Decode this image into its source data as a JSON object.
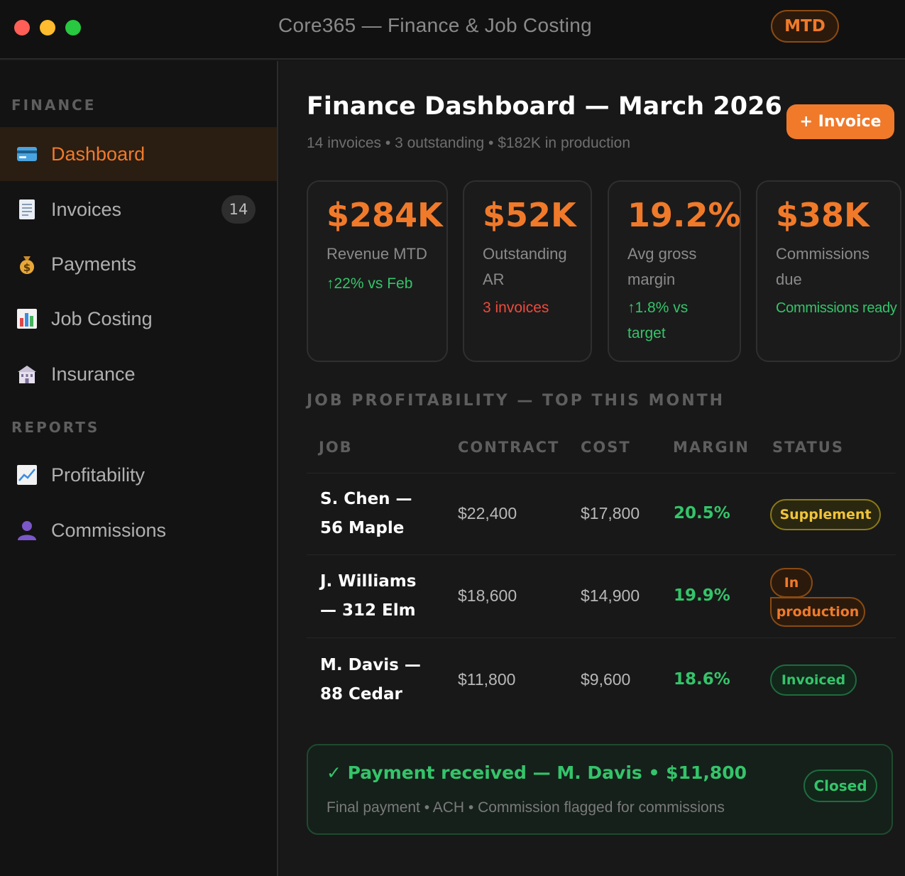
{
  "window": {
    "title": "Core365 — Finance & Job Costing",
    "period_badge": "MTD"
  },
  "sidebar": {
    "sections": [
      {
        "label": "FINANCE",
        "items": [
          {
            "label": "Dashboard",
            "icon": "credit-card-icon",
            "active": true
          },
          {
            "label": "Invoices",
            "icon": "document-icon",
            "badge": "14"
          },
          {
            "label": "Payments",
            "icon": "money-bag-icon"
          },
          {
            "label": "Job Costing",
            "icon": "bar-chart-icon"
          },
          {
            "label": "Insurance",
            "icon": "building-icon"
          }
        ]
      },
      {
        "label": "REPORTS",
        "items": [
          {
            "label": "Profitability",
            "icon": "trend-chart-icon"
          },
          {
            "label": "Commissions",
            "icon": "person-icon"
          }
        ]
      }
    ]
  },
  "header": {
    "title": "Finance Dashboard — March 2026",
    "subtitle": "14 invoices • 3 outstanding • $182K in production",
    "new_button": "+ Invoice"
  },
  "kpis": [
    {
      "value": "$284K",
      "label_lines": [
        "Revenue MTD"
      ],
      "note_lines": [
        "↑22% vs Feb"
      ],
      "note_color": "#34c46a"
    },
    {
      "value": "$52K",
      "label_lines": [
        "Outstanding",
        "AR"
      ],
      "note_lines": [
        "3 invoices"
      ],
      "note_color": "#ef4a3c"
    },
    {
      "value": "19.2%",
      "label_lines": [
        "Avg gross",
        "margin"
      ],
      "note_lines": [
        "↑1.8% vs",
        "target"
      ],
      "note_color": "#34c46a"
    },
    {
      "value": "$38K",
      "label_lines": [
        "Commissions",
        "due"
      ],
      "note_lines": [
        "Commissions ready"
      ],
      "note_color": "#34c46a"
    }
  ],
  "table": {
    "title": "JOB PROFITABILITY — TOP THIS MONTH",
    "headers": [
      "JOB",
      "CONTRACT",
      "COST",
      "MARGIN",
      "STATUS"
    ],
    "rows": [
      {
        "job_lines": [
          "S. Chen —",
          "56 Maple"
        ],
        "contract": "$22,400",
        "cost": "$17,800",
        "margin": "20.5%",
        "status": "Supplement"
      },
      {
        "job_lines": [
          "J. Williams",
          "— 312 Elm"
        ],
        "contract": "$18,600",
        "cost": "$14,900",
        "margin": "19.9%",
        "status_lines": [
          "In",
          "production"
        ]
      },
      {
        "job_lines": [
          "M. Davis —",
          "88 Cedar"
        ],
        "contract": "$11,800",
        "cost": "$9,600",
        "margin": "18.6%",
        "status": "Invoiced"
      }
    ]
  },
  "payment_notice": {
    "title": "✓ Payment received — M. Davis • $11,800",
    "subtitle": "Final payment • ACH • Commission flagged for commissions",
    "badge": "Closed"
  },
  "colors": {
    "accent": "#f07a2a",
    "positive": "#34c46a",
    "negative": "#ef4a3c",
    "warning": "#f0c43a"
  }
}
